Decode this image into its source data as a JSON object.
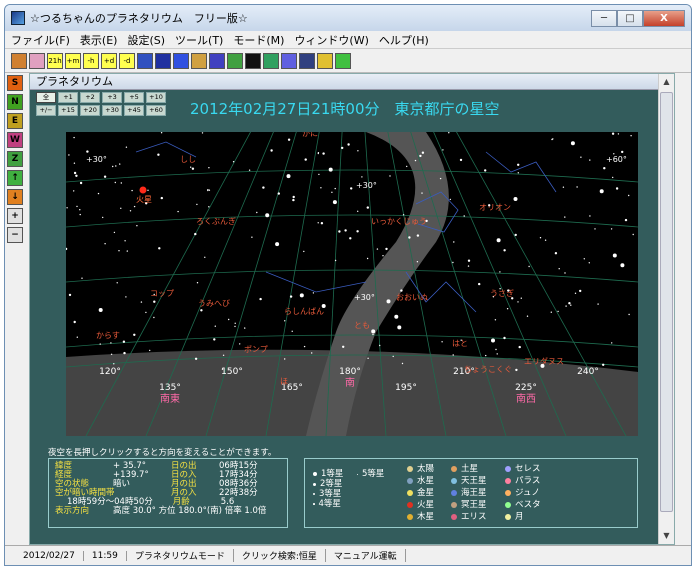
{
  "window": {
    "title": "☆つるちゃんのプラネタリウム　フリー版☆",
    "controls": [
      "─",
      "□",
      "X"
    ]
  },
  "menu": [
    "ファイル(F)",
    "表示(E)",
    "設定(S)",
    "ツール(T)",
    "モード(M)",
    "ウィンドウ(W)",
    "ヘルプ(H)"
  ],
  "toolbar": {
    "buttons": [
      {
        "label": "",
        "color": "#d08030"
      },
      {
        "label": "",
        "color": "#e0a0c0"
      },
      {
        "label": "21h",
        "color": "#ffff50"
      },
      {
        "label": "+m",
        "color": "#ffff50"
      },
      {
        "label": "-h",
        "color": "#ffff50"
      },
      {
        "label": "+d",
        "color": "#ffff50"
      },
      {
        "label": "-d",
        "color": "#ffff50"
      },
      {
        "label": "",
        "color": "#3050c0"
      },
      {
        "label": "",
        "color": "#2030a0"
      },
      {
        "label": "",
        "color": "#3050e0"
      },
      {
        "label": "",
        "color": "#d0a040"
      },
      {
        "label": "",
        "color": "#4040c0"
      },
      {
        "label": "",
        "color": "#40a040"
      },
      {
        "label": "",
        "color": "#101010"
      },
      {
        "label": "",
        "color": "#30a060"
      },
      {
        "label": "",
        "color": "#6060e0"
      },
      {
        "label": "",
        "color": "#304080"
      },
      {
        "label": "",
        "color": "#e0c030"
      },
      {
        "label": "",
        "color": "#40c040"
      }
    ]
  },
  "sidebar": [
    {
      "label": "S",
      "color": "#e06010"
    },
    {
      "label": "N",
      "color": "#40a020"
    },
    {
      "label": "E",
      "color": "#c0a020"
    },
    {
      "label": "W",
      "color": "#c04080"
    },
    {
      "label": "Z",
      "color": "#40a040"
    },
    {
      "label": "↑",
      "color": "#40b040"
    },
    {
      "label": "↓",
      "color": "#e08020"
    },
    {
      "label": "+",
      "color": "#e0e0e0"
    },
    {
      "label": "−",
      "color": "#e0e0e0"
    }
  ],
  "panel": {
    "title": "プラネタリウム",
    "view_buttons_row1": [
      "全",
      "+1",
      "+2",
      "+3",
      "+5",
      "+10"
    ],
    "view_buttons_row2": [
      "+/−",
      "+15",
      "+20",
      "+30",
      "+45",
      "+60"
    ]
  },
  "sky": {
    "title": "2012年02月27日21時00分　東京都庁の星空",
    "altitudes": [
      "+30°",
      "+20°",
      "+10°",
      "±0°"
    ],
    "azimuths": [
      {
        "deg": "120°"
      },
      {
        "deg": "135°",
        "dir": "南東"
      },
      {
        "deg": "150°"
      },
      {
        "deg": "165°"
      },
      {
        "deg": "180°",
        "dir": "南"
      },
      {
        "deg": "195°"
      },
      {
        "deg": "210°"
      },
      {
        "deg": "225°",
        "dir": "南西"
      },
      {
        "deg": "240°"
      }
    ],
    "grid_labels": [
      "+30°",
      "+30°",
      "+60°",
      "+30°"
    ],
    "constellations": [
      "しし",
      "ろくぶんぎ",
      "いっかくじゅう",
      "オリオン",
      "コップ",
      "うみへび",
      "らしんばん",
      "おおいぬ",
      "うさぎ",
      "ポンプ",
      "とも",
      "からす",
      "ほ",
      "はと",
      "ちょうこくぐ",
      "エリダヌス",
      "かに"
    ],
    "planet_label": "火星"
  },
  "message": "夜空を長押しクリックすると方向を変えることができます。",
  "info": {
    "rows": [
      {
        "label": "緯度",
        "value": "+ 35.7°",
        "label2": "日の出",
        "value2": "06時15分"
      },
      {
        "label": "経度",
        "value": "+139.7°",
        "label2": "日の入",
        "value2": "17時34分"
      },
      {
        "label": "空の状態",
        "value": "暗い",
        "label2": "月の出",
        "value2": "08時36分"
      },
      {
        "label": "空が暗い時間帯",
        "value": "",
        "label2": "月の入",
        "value2": "22時38分"
      }
    ],
    "dark_time": "18時59分〜04時50分",
    "moon_age_label": "月齢",
    "moon_age": "5.6",
    "direction_label": "表示方向",
    "direction_value": "高度 30.0°  方位 180.0°(南)  倍率 1.0倍"
  },
  "legend": {
    "magnitudes": [
      "1等星",
      "2等星",
      "3等星",
      "4等星",
      "5等星"
    ],
    "bodies": [
      {
        "name": "太陽",
        "color": "#e0d090"
      },
      {
        "name": "水星",
        "color": "#80a0c0"
      },
      {
        "name": "金星",
        "color": "#f0e060"
      },
      {
        "name": "火星",
        "color": "#e03020"
      },
      {
        "name": "木星",
        "color": "#e0b030"
      },
      {
        "name": "土星",
        "color": "#e0a060"
      },
      {
        "name": "天王星",
        "color": "#80c0e0"
      },
      {
        "name": "海王星",
        "color": "#6080e0"
      },
      {
        "name": "冥王星",
        "color": "#c0a080"
      },
      {
        "name": "エリス",
        "color": "#e06080"
      },
      {
        "name": "セレス",
        "color": "#a0a0ff"
      },
      {
        "name": "パラス",
        "color": "#ff80a0"
      },
      {
        "name": "ジュノ",
        "color": "#ffb060"
      },
      {
        "name": "ベスタ",
        "color": "#90ff90"
      },
      {
        "name": "月",
        "color": "#f0f0a0"
      }
    ]
  },
  "status": [
    "2012/02/27",
    "11:59",
    "プラネタリウムモード",
    "クリック検索:恒星",
    "マニュアル運転"
  ]
}
